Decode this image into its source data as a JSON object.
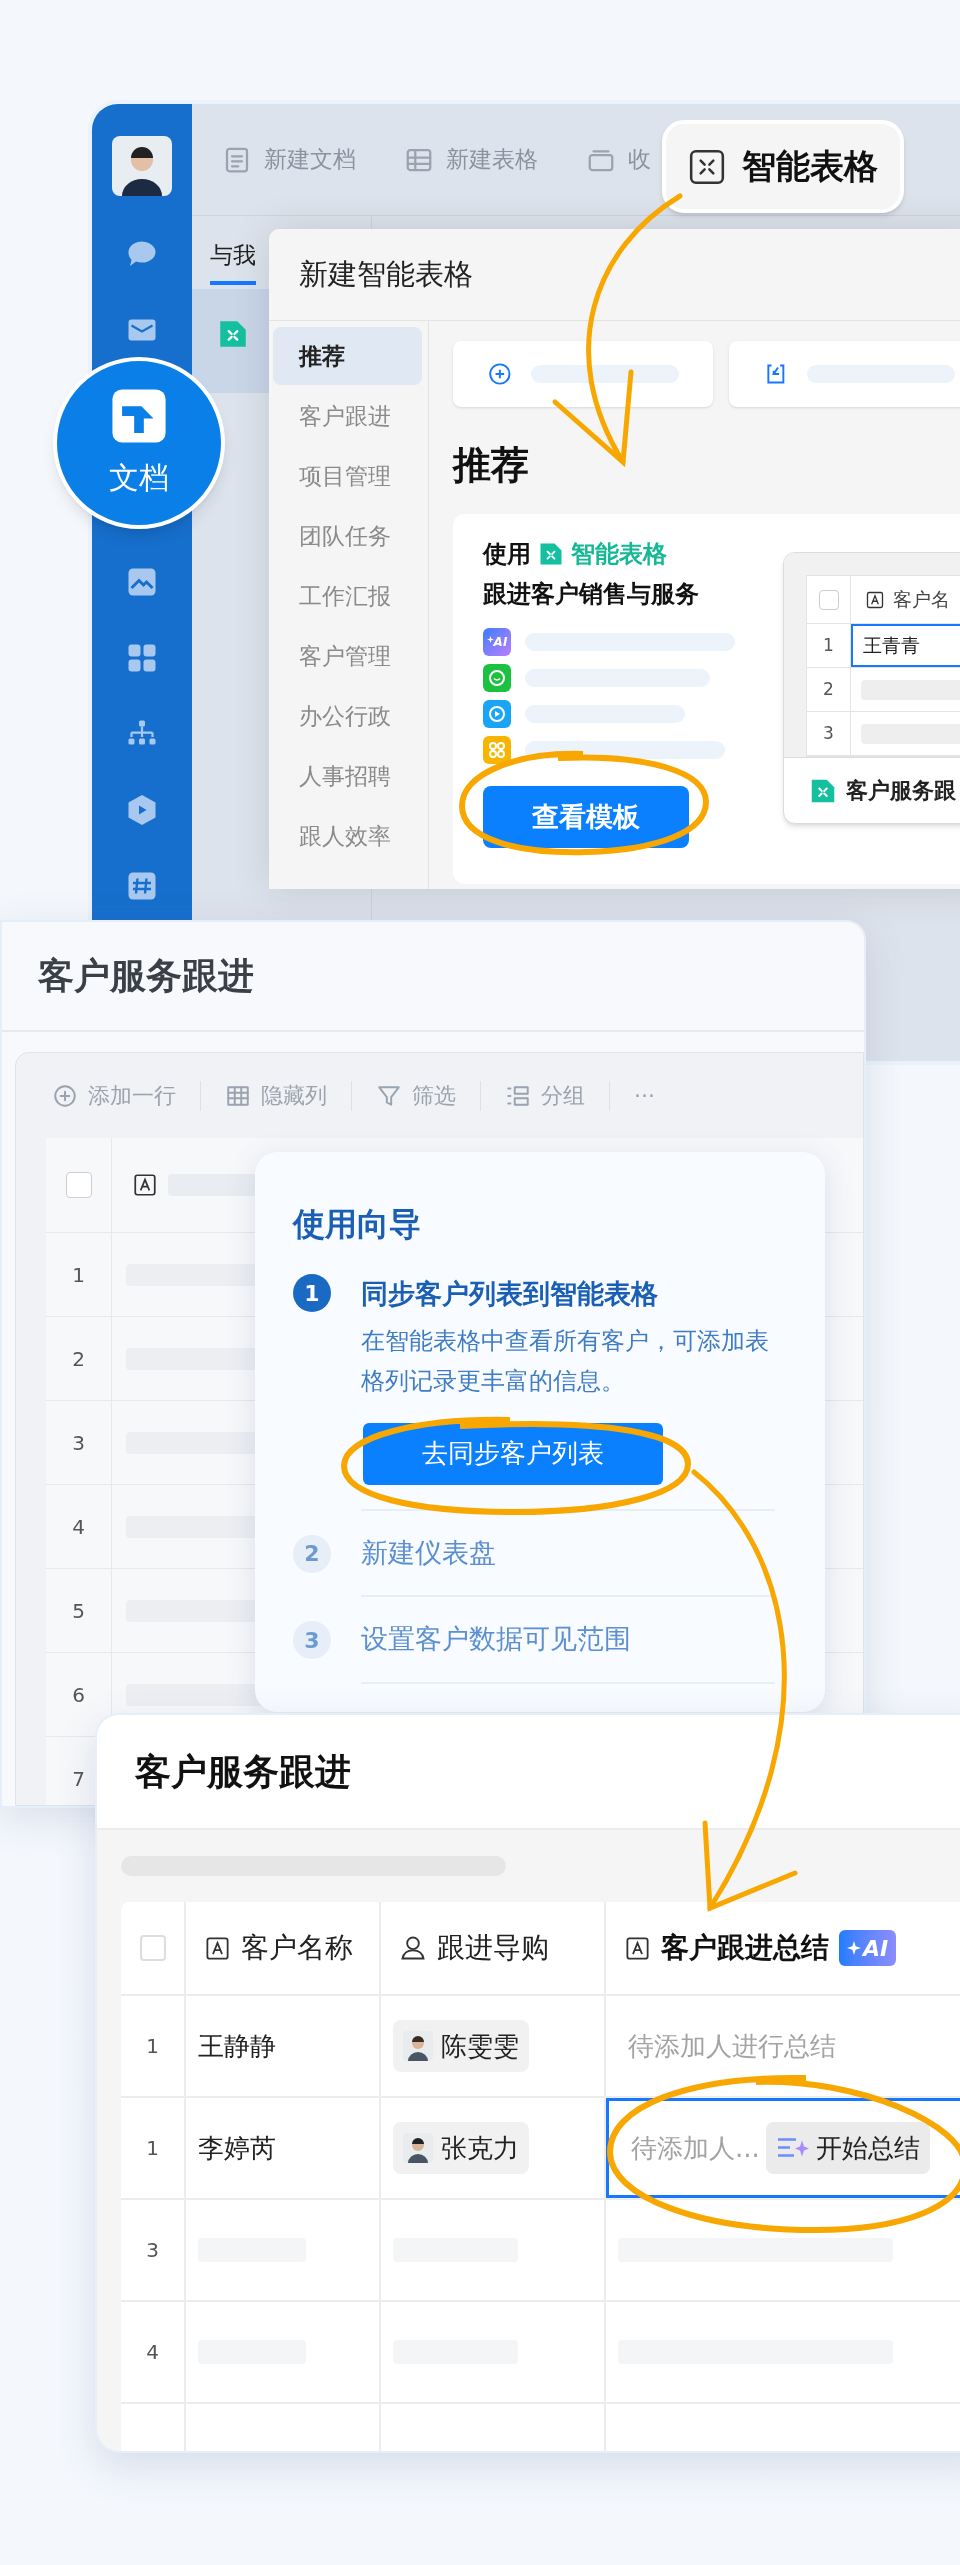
{
  "app_window": {
    "toolbar": [
      {
        "label": "新建文档",
        "kind": "doc"
      },
      {
        "label": "新建表格",
        "kind": "sheet"
      },
      {
        "label": "收",
        "kind": "box"
      }
    ],
    "tab": {
      "label": "与我",
      "selected": true
    },
    "dialog": {
      "title": "新建智能表格",
      "nav": [
        {
          "label": "推荐",
          "selected": true
        },
        {
          "label": "客户跟进",
          "selected": false
        },
        {
          "label": "项目管理",
          "selected": false
        },
        {
          "label": "团队任务",
          "selected": false
        },
        {
          "label": "工作汇报",
          "selected": false
        },
        {
          "label": "客户管理",
          "selected": false
        },
        {
          "label": "办公行政",
          "selected": false
        },
        {
          "label": "人事招聘",
          "selected": false
        },
        {
          "label": "跟人效率",
          "selected": false
        }
      ],
      "quick_actions": [
        {
          "kind": "create"
        },
        {
          "kind": "import"
        }
      ],
      "heading": "推荐",
      "template_card": {
        "title_prefix": "使用",
        "title_product": "智能表格",
        "subtitle": "跟进客户销售与服务",
        "features": [
          {
            "kind": "ai",
            "label": "AI"
          },
          {
            "kind": "chat"
          },
          {
            "kind": "play"
          },
          {
            "kind": "apps"
          }
        ],
        "button": "查看模板",
        "preview": {
          "checked": false,
          "column": "客户名",
          "rows": [
            {
              "number": "1",
              "name": "王青青",
              "selected": true
            },
            {
              "number": "2",
              "selected": false
            },
            {
              "number": "3",
              "selected": false
            }
          ],
          "footer": "客户服务跟"
        }
      }
    }
  },
  "feature_badge": {
    "label": "智能表格"
  },
  "app_badge": {
    "label": "文档"
  },
  "sheet_window": {
    "title": "客户服务跟进",
    "toolbar": [
      {
        "label": "添加一行",
        "kind": "add"
      },
      {
        "label": "隐藏列",
        "kind": "columns"
      },
      {
        "label": "筛选",
        "kind": "filter"
      },
      {
        "label": "分组",
        "kind": "group"
      },
      {
        "label": "···",
        "kind": "more"
      }
    ],
    "header_checked": false,
    "rows": [
      {
        "number": "1",
        "kind": "placeholder"
      },
      {
        "number": "2",
        "kind": "placeholder"
      },
      {
        "number": "3",
        "kind": "placeholder"
      },
      {
        "number": "4",
        "kind": "placeholder"
      },
      {
        "number": "5",
        "kind": "placeholder"
      },
      {
        "number": "6",
        "kind": "placeholder"
      },
      {
        "number": "7",
        "kind": "blank"
      }
    ],
    "guide": {
      "title": "使用向导",
      "steps": [
        {
          "number": "1",
          "title": "同步客户列表到智能表格",
          "description": "在智能表格中查看所有客户，可添加表格列记录更丰富的信息。",
          "button": "去同步客户列表",
          "active": true
        },
        {
          "number": "2",
          "title": "新建仪表盘",
          "active": false
        },
        {
          "number": "3",
          "title": "设置客户数据可见范围",
          "active": false
        }
      ]
    }
  },
  "summary_window": {
    "title": "客户服务跟进",
    "header_checked": false,
    "columns": [
      {
        "label": "客户名称",
        "kind": "text"
      },
      {
        "label": "跟进导购",
        "kind": "person"
      },
      {
        "label": "客户跟进总结",
        "kind": "text",
        "badge": "AI"
      }
    ],
    "rows": [
      {
        "kind": "filled",
        "number": "1",
        "name": "王静静",
        "person": "陈雯雯",
        "summary": "待添加人进行总结",
        "selected": false
      },
      {
        "kind": "filled",
        "number": "1",
        "name": "李婷芮",
        "person": "张克力",
        "summary": "待添加人...",
        "action": "开始总结",
        "selected": true
      },
      {
        "kind": "placeholder",
        "number": "3"
      },
      {
        "kind": "placeholder",
        "number": "4"
      },
      {
        "kind": "empty"
      }
    ]
  }
}
